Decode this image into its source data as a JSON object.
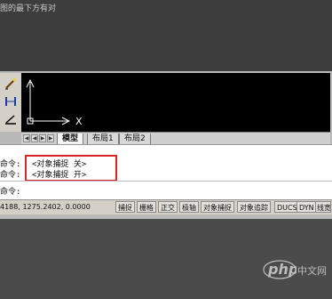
{
  "caption": "图的最下方有对",
  "viewport": {
    "axis_x_label": "X"
  },
  "tabs": [
    {
      "label": "模型",
      "active": true
    },
    {
      "label": "布局1",
      "active": false
    },
    {
      "label": "布局2",
      "active": false
    }
  ],
  "command": {
    "lines": [
      {
        "label": "命令:",
        "text": "<对象捕捉 关>"
      },
      {
        "label": "命令:",
        "text": "<对象捕捉 开>"
      },
      {
        "label": "命令:",
        "text": ""
      }
    ]
  },
  "status": {
    "coordinates": "4188,  1275.2402, 0.0000",
    "buttons": [
      "捕捉",
      "栅格",
      "正交",
      "极轴",
      "对象捕捉",
      "对象追踪",
      "DUCS",
      "DYN",
      "线宽"
    ]
  },
  "watermark": {
    "brand": "php",
    "suffix": "中文网"
  },
  "colors": {
    "highlight": "#d62626",
    "viewport_bg": "#000000"
  }
}
